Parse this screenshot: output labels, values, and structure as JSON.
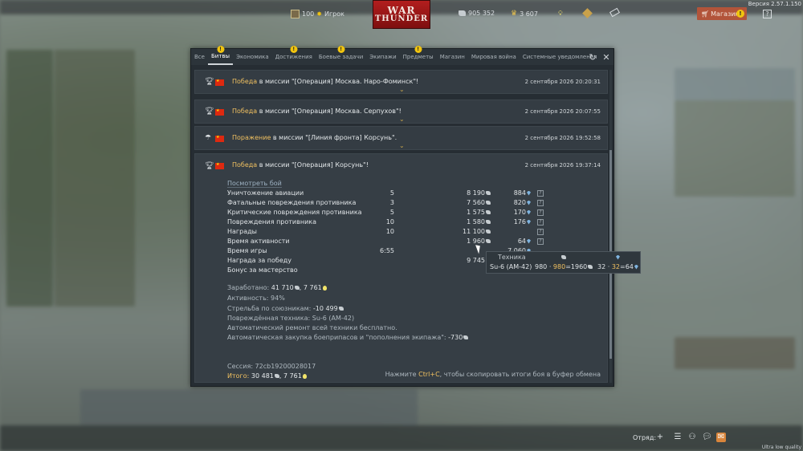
{
  "version": "Версия 2.57.1.150",
  "topbar": {
    "rank": "100",
    "player": "Игрок",
    "silver": "905 352",
    "gold": "3 607",
    "logo_line1": "WAR",
    "logo_line2": "THUNDER",
    "shop": "Магазин",
    "help": "?"
  },
  "tabs": [
    {
      "label": "Все",
      "warn": false,
      "active": false
    },
    {
      "label": "Битвы",
      "warn": true,
      "active": true
    },
    {
      "label": "Экономика",
      "warn": false,
      "active": false
    },
    {
      "label": "Достижения",
      "warn": true,
      "active": false
    },
    {
      "label": "Боевые задачи",
      "warn": true,
      "active": false
    },
    {
      "label": "Экипажи",
      "warn": false,
      "active": false
    },
    {
      "label": "Предметы",
      "warn": true,
      "active": false
    },
    {
      "label": "Магазин",
      "warn": false,
      "active": false
    },
    {
      "label": "Мировая война",
      "warn": false,
      "active": false
    },
    {
      "label": "Системные уведомления",
      "warn": false,
      "active": false
    }
  ],
  "messages": [
    {
      "result": "Победа",
      "rest": " в миссии \"[Операция] Москва. Наро-Фоминск\"!",
      "date": "2 сентября 2026 20:20:31"
    },
    {
      "result": "Победа",
      "rest": " в миссии \"[Операция] Москва. Серпухов\"!",
      "date": "2 сентября 2026 20:07:55"
    },
    {
      "result": "Поражение",
      "rest": " в миссии \"[Линия фронта] Корсунь\".",
      "date": "2 сентября 2026 19:52:58"
    }
  ],
  "detail": {
    "result": "Победа",
    "rest": " в миссии \"[Операция] Корсунь\"!",
    "date": "2 сентября 2026 19:37:14",
    "view_link": "Посмотреть бой",
    "rows": [
      {
        "label": "Уничтожение авиации",
        "count": "5",
        "silver": "8 190",
        "rp": "884"
      },
      {
        "label": "Фатальные повреждения противника",
        "count": "3",
        "silver": "7 560",
        "rp": "820"
      },
      {
        "label": "Критические повреждения противника",
        "count": "5",
        "silver": "1 575",
        "rp": "170"
      },
      {
        "label": "Повреждения противника",
        "count": "10",
        "silver": "1 580",
        "rp": "176"
      },
      {
        "label": "Награды",
        "count": "10",
        "silver": "11 100",
        "rp": ""
      },
      {
        "label": "Время активности",
        "count": "",
        "silver": "1 960",
        "rp": "64"
      },
      {
        "label": "Время игры",
        "count": "6:55",
        "silver": "",
        "rp": "7 060"
      },
      {
        "label": "Награда за победу",
        "count": "",
        "silver": "9 745",
        "rp": ""
      },
      {
        "label": "Бонус за мастерство",
        "count": "",
        "silver": "",
        "rp": ""
      }
    ],
    "earned_label": "Заработано: ",
    "earned_silver": "41 710",
    "earned_rp": ", 7 761",
    "activity": "Активность: 94%",
    "teamkill_label": "Стрельба по союзникам: ",
    "teamkill_value": "-10 499",
    "damaged_label": "Повреждённая техника: ",
    "damaged_value": "Su-6 (AM-42)",
    "repair": "Автоматический ремонт всей техники бесплатно.",
    "ammo_label": "Автоматическая закупка боеприпасов и \"пополнения экипажа\": ",
    "ammo_value": "-730",
    "session": "Сессия: 72cb19200028017",
    "total_label": "Итого: ",
    "total_silver": "30 481",
    "total_rp": ", 7 761",
    "copy_hint_1": "Нажмите ",
    "copy_hint_key": "Ctrl+C",
    "copy_hint_2": ", чтобы скопировать итоги боя в буфер обмена"
  },
  "tooltip": {
    "header_vehicle": "Техника",
    "vehicle": "Su-6 (AM-42)",
    "silver_breakdown_a": "980",
    "silver_breakdown_b": "980",
    "silver_breakdown_c": "1960",
    "rp_breakdown_a": "32",
    "rp_breakdown_b": "32",
    "rp_breakdown_c": "64"
  },
  "bottombar": {
    "squad": "Отряд:",
    "quality": "Ultra low quality"
  }
}
